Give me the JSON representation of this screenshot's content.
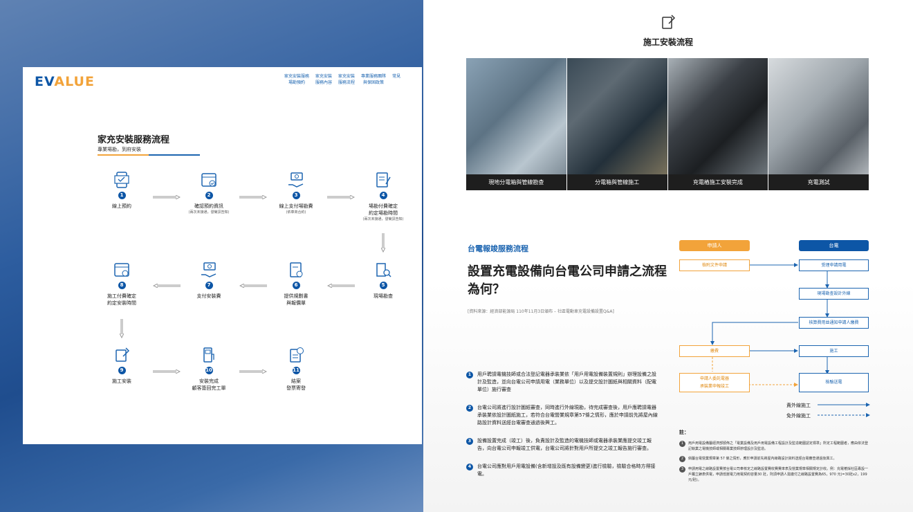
{
  "left": {
    "logo": {
      "prefix": "EV",
      "rest": "ALUE"
    },
    "nav": [
      "家充安裝服務\n場勘預約",
      "家充安裝\n服務內容",
      "家充安裝\n服務流程",
      "專業服務團隊\n與保固政策",
      "常見"
    ],
    "title": "家充安裝服務流程",
    "subtitle": "專業場勘，到府安裝",
    "steps": [
      {
        "num": "1",
        "label": "線上預約",
        "note": ""
      },
      {
        "num": "2",
        "label": "確認預約資訊",
        "note": "(兩次未接通，發簡訊告知)"
      },
      {
        "num": "3",
        "label": "線上支付場勘費",
        "note": "(依車商合約)"
      },
      {
        "num": "4",
        "label": "場勘付費確定\n約定場勘時間",
        "note": "(兩次未接通，發簡訊告知)"
      },
      {
        "num": "5",
        "label": "現場勘查",
        "note": ""
      },
      {
        "num": "6",
        "label": "提供規劃書\n與報價單",
        "note": ""
      },
      {
        "num": "7",
        "label": "支付安裝費",
        "note": ""
      },
      {
        "num": "8",
        "label": "施工付費確定\n約定安裝時間",
        "note": ""
      },
      {
        "num": "9",
        "label": "施工安裝",
        "note": ""
      },
      {
        "num": "10",
        "label": "安裝完成\n顧客簽回完工單",
        "note": ""
      },
      {
        "num": "11",
        "label": "結案\n發票寄發",
        "note": ""
      }
    ]
  },
  "right": {
    "title": "施工安裝流程",
    "photos": [
      "現地分電箱與管線勘查",
      "分電箱與管線施工",
      "充電樁施工安裝完成",
      "充電測試"
    ],
    "section": "台電報竣服務流程",
    "heading": "設置充電設備向台電公司申請之流程為何？",
    "source": "[資料來源：經濟部能源局 110年11月3日頒布 – 社區電動車充電設備設置Q&A]",
    "notes": [
      "用戶聘請電機技師或合法登記電器承裝業依「用戶用電設備裝置規則」辦理設備之設計及監造，並向台電公司申請用電（業務單位）以及提交設計圖紙與相關資料（配電單位）施行審查",
      "台電公司將進行設計圖紙審查，同時進行外線現勘，待完成審查後，用戶應聘請電器承裝業依設計圖紙施工，若符合台電營業規章第57條之情形，應於申請前先將屋內線路設計資料送經台電審查通過後興工。",
      "設備設置完成（竣工）後，負責設計及監造的電機技師或電器承裝業應提交竣工報告，向台電公司申報竣工供電，台電公司將針對用戶所提交之竣工報告施行審查。",
      "台電公司應對用戶用電設備(含新增設及既有設備變更)進行檢驗，檢驗合格時方得接電。"
    ],
    "flow": {
      "head_left": "申請人",
      "head_right": "台電",
      "b1": "檢附文件申請",
      "b2": "受理申請用電",
      "b3": "現場勘查設計外線",
      "b4": "核算費用並通知申請人繳費",
      "b5": "繳費",
      "b6": "施工",
      "b7": "申請人委託電器\n承裝業申報竣工",
      "b8": "檢驗送電",
      "legend1": "責外線施工",
      "legend2": "免外線施工"
    },
    "remarks_title": "註：",
    "remarks": [
      "用戶用電設備屬經濟部頒佈之「電業設備及用戶用電設備工程設計及監造範圍認定標準」所定工程範圍者，應由依法登記執業之電機技師或相關專業技師辦理設計及監造。",
      "倘屬台電營業規章第 57 條之情形，應於申請前先將屋內線路設計資料送經台電審查通過後興工。",
      "申請用電之線路設置費按台電公司奉核定之線路設置費收費費率表及營業規章相關規定計收。例：充電樁採社區專設一戶獨立錶表供電，申請低壓電力用電契約容量30 瓩，則須申請人需繳付之線路設置費為65，970 元(=30瓩x2，199元/瓩)。"
    ]
  }
}
